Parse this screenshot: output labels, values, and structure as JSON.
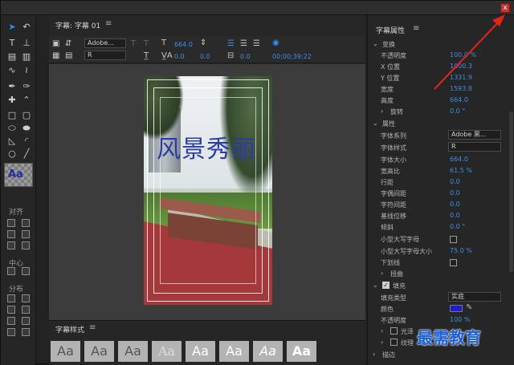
{
  "window": {
    "close_glyph": "x"
  },
  "tools": {
    "align_label": "对齐",
    "center_label": "中心",
    "distribute_label": "分布",
    "style_swatch": "Aa"
  },
  "editor": {
    "tab_title": "字幕: 字幕 01",
    "menu_glyph": "≡",
    "font_family": "Adobe...",
    "font_style": "R",
    "font_size": "664.0",
    "kerning": "0.0",
    "leading": "0.0",
    "tracking": "0.0",
    "timecode": "00;00;39;22"
  },
  "canvas": {
    "title_text": "风景秀丽"
  },
  "styles_panel": {
    "title": "字幕样式",
    "menu_glyph": "≡",
    "swatches": [
      "Aa",
      "Aa",
      "Aa",
      "Aa",
      "Aa",
      "Aa",
      "Aa",
      "Aa"
    ]
  },
  "properties": {
    "title": "字幕属性",
    "menu_glyph": "≡",
    "transform": {
      "header": "变换",
      "opacity_label": "不透明度",
      "opacity": "100.0 %",
      "x_label": "X 位置",
      "x": "1000.3",
      "y_label": "Y 位置",
      "y": "1331.9",
      "width_label": "宽度",
      "width": "1593.8",
      "height_label": "高度",
      "height": "664.0",
      "rotation_label": "旋转",
      "rotation": "0.0 °"
    },
    "attributes": {
      "header": "属性",
      "family_label": "字体系列",
      "family": "Adobe 黑...",
      "style_label": "字体样式",
      "style": "R",
      "size_label": "字体大小",
      "size": "664.0",
      "aspect_label": "宽高比",
      "aspect": "61.5 %",
      "leading_label": "行距",
      "leading": "0.0",
      "kerning_label": "字偶间距",
      "kerning": "0.0",
      "tracking_label": "字符间距",
      "tracking": "0.0",
      "baseline_label": "基线位移",
      "baseline": "0.0",
      "slant_label": "倾斜",
      "slant": "0.0 °",
      "smallcaps_label": "小型大写字母",
      "smallcaps_size_label": "小型大写字母大小",
      "smallcaps_size": "75.0 %",
      "underline_label": "下划线",
      "distort_label": "扭曲"
    },
    "fill": {
      "header": "填充",
      "type_label": "填充类型",
      "type": "实底",
      "color_label": "颜色",
      "color": "#1d1dd6",
      "opacity_label": "不透明度",
      "opacity": "100 %",
      "sheen_label": "光泽",
      "texture_label": "纹理"
    },
    "stroke": {
      "header": "描边"
    }
  },
  "watermark": "最需教育"
}
